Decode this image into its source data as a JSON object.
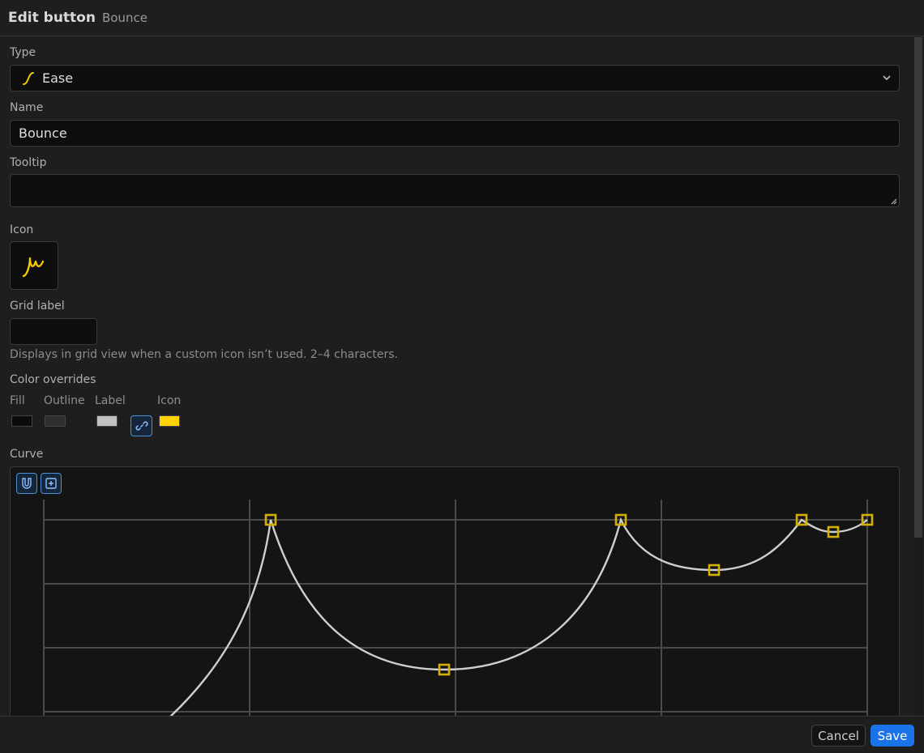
{
  "header": {
    "title": "Edit button",
    "subtitle": "Bounce"
  },
  "type_field": {
    "label": "Type",
    "value": "Ease",
    "icon": "ease-curve-icon"
  },
  "name_field": {
    "label": "Name",
    "value": "Bounce"
  },
  "tooltip_field": {
    "label": "Tooltip",
    "value": ""
  },
  "icon_field": {
    "label": "Icon",
    "icon": "bounce-curve-icon",
    "icon_color": "#f5c800"
  },
  "grid_label": {
    "label": "Grid label",
    "value": "",
    "help": "Displays in grid view when a custom icon isn’t used. 2–4 characters."
  },
  "color_overrides": {
    "label": "Color overrides",
    "fill_label": "Fill",
    "outline_label": "Outline",
    "label_label": "Label",
    "icon_label": "Icon",
    "fill_color": "#0b0b0b",
    "outline_color": "#2e2e2e",
    "label_color": "#c0c0c0",
    "icon_color": "#ffd400"
  },
  "curve": {
    "label": "Curve",
    "tools": [
      "magnet-icon",
      "add-point-icon"
    ],
    "line_color": "#cfcfcf",
    "point_color": "#d4b000"
  },
  "footer": {
    "cancel_label": "Cancel",
    "save_label": "Save"
  }
}
